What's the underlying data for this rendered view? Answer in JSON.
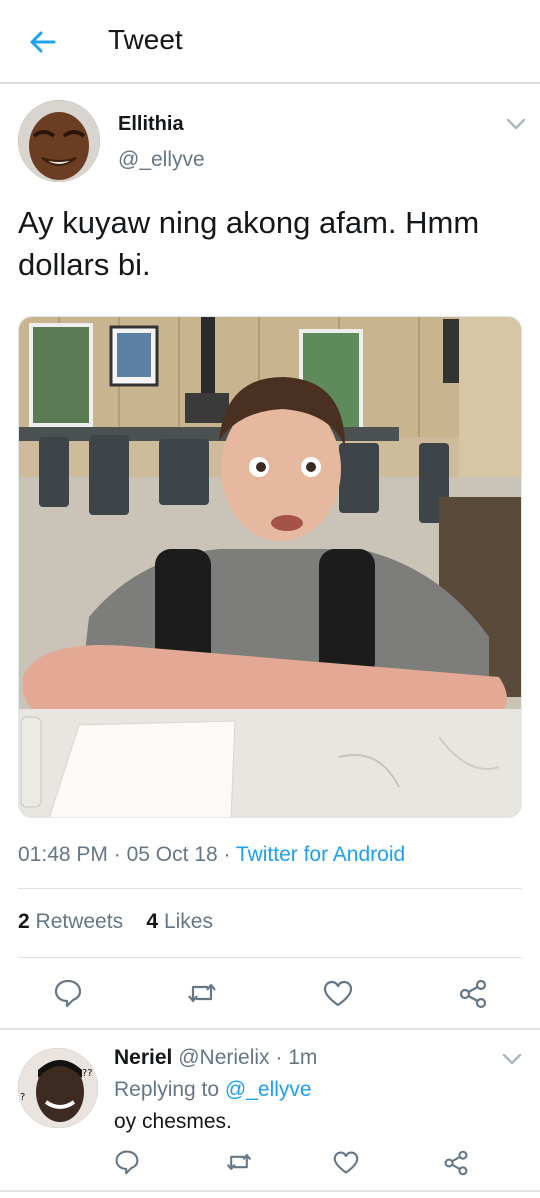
{
  "header": {
    "title": "Tweet",
    "back_icon": "arrow-left-icon"
  },
  "tweet": {
    "author_name": "Ellithia",
    "author_handle": "@_ellyve",
    "text": "Ay kuyaw ning akong afam. Hmm dollars bi.",
    "time": "01:48 PM",
    "date": "05 Oct 18",
    "source": "Twitter for Android",
    "retweets_count": "2",
    "retweets_label": "Retweets",
    "likes_count": "4",
    "likes_label": "Likes"
  },
  "reply": {
    "name": "Neriel",
    "handle": "@Nerielix",
    "time": "1m",
    "replying_label": "Replying to",
    "replying_to": "@_ellyve",
    "text": "oy chesmes."
  },
  "colors": {
    "accent": "#1da1f2",
    "secondary_text": "#657786",
    "primary_text": "#14171a"
  }
}
